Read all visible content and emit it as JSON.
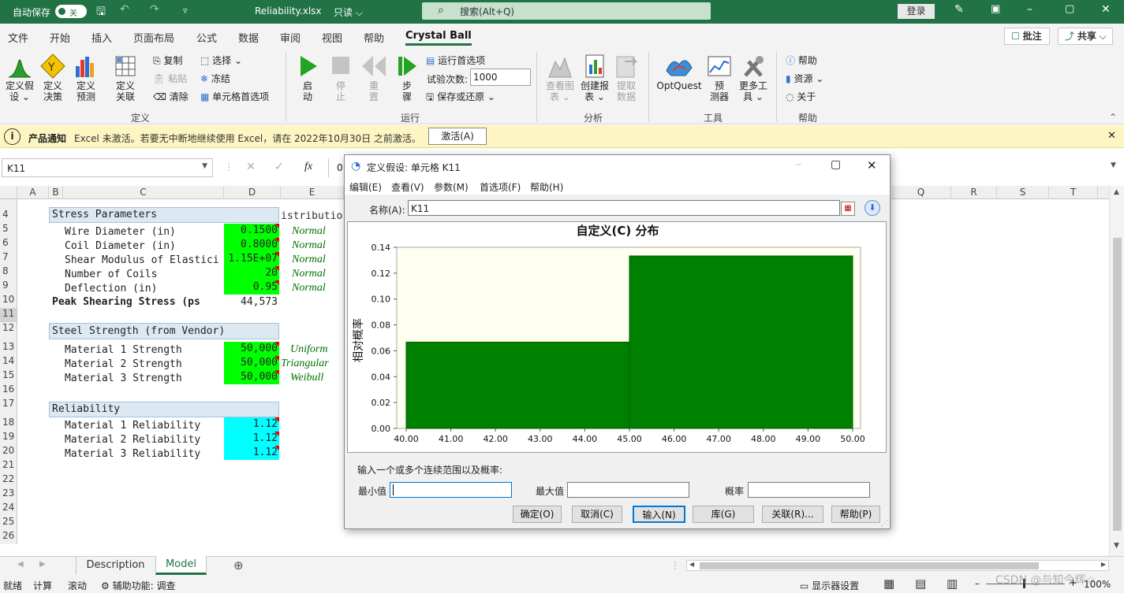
{
  "titlebar": {
    "autosave_label": "自动保存",
    "autosave_state": "关",
    "filename": "Reliability.xlsx",
    "mode": "只读",
    "search_placeholder": "搜索(Alt+Q)",
    "login": "登录"
  },
  "menu": {
    "tabs": [
      "文件",
      "开始",
      "插入",
      "页面布局",
      "公式",
      "数据",
      "审阅",
      "视图",
      "帮助",
      "Crystal Ball"
    ],
    "active_tab": "Crystal Ball",
    "comments_btn": "批注",
    "share_btn": "共享"
  },
  "ribbon": {
    "define": {
      "def_assumption": [
        "定义假",
        "设 ⌄"
      ],
      "def_decision": [
        "定义",
        "决策"
      ],
      "def_forecast": [
        "定义",
        "预测"
      ],
      "def_correlation": [
        "定义",
        "关联"
      ],
      "copy": "复制",
      "paste": "粘贴",
      "clear": "清除",
      "select": "选择 ⌄",
      "freeze": "冻结",
      "cell_prefs": "单元格首选项",
      "group": "定义"
    },
    "run": {
      "start": [
        "启",
        "动"
      ],
      "stop": [
        "停",
        "止"
      ],
      "reset": [
        "重",
        "置"
      ],
      "step": [
        "步",
        "骤"
      ],
      "run_prefs": "运行首选项",
      "trials_label": "试验次数:",
      "trials_value": "1000",
      "save_restore": "保存或还原 ⌄",
      "group": "运行"
    },
    "analyze": {
      "view_charts": [
        "查看图",
        "表 ⌄"
      ],
      "create_report": [
        "创建报",
        "表 ⌄"
      ],
      "extract_data": [
        "提取",
        "数据"
      ],
      "group": "分析"
    },
    "tools": {
      "optquest": "OptQuest",
      "predictor": [
        "预",
        "测器"
      ],
      "more_tools": [
        "更多工",
        "具 ⌄"
      ],
      "group": "工具"
    },
    "help": {
      "help": "帮助",
      "resources": "资源 ⌄",
      "about": "关于",
      "group": "帮助"
    }
  },
  "notice": {
    "title": "产品通知",
    "message": "Excel 未激活。若要无中断地继续使用 Excel，请在 2022年10月30日 之前激活。",
    "button": "激活(A)"
  },
  "formula_bar": {
    "name_box": "K11",
    "fx": "fx",
    "content": "0"
  },
  "grid": {
    "columns": [
      "A",
      "B",
      "C",
      "D",
      "E",
      "Q",
      "R",
      "S",
      "T"
    ],
    "rows": [
      "4",
      "5",
      "6",
      "7",
      "8",
      "9",
      "10",
      "11",
      "12",
      "13",
      "14",
      "15",
      "16",
      "17",
      "18",
      "19",
      "20",
      "21",
      "22",
      "23",
      "24",
      "25",
      "26"
    ],
    "stress_header": "Stress Parameters",
    "e4_text": "istributio",
    "stress_rows": [
      {
        "label": "Wire Diameter (in)",
        "value": "0.1500",
        "dist": "Normal"
      },
      {
        "label": "Coil Diameter (in)",
        "value": "0.8000",
        "dist": "Normal"
      },
      {
        "label": "Shear Modulus of Elastici",
        "value": "1.15E+07",
        "dist": "Normal"
      },
      {
        "label": "Number of Coils",
        "value": "20",
        "dist": "Normal"
      },
      {
        "label": "Deflection (in)",
        "value": "0.95",
        "dist": "Normal"
      }
    ],
    "peak_label": "Peak Shearing Stress (ps",
    "peak_value": "44,573",
    "steel_header": "Steel Strength (from Vendor)",
    "steel_rows": [
      {
        "label": "Material 1 Strength",
        "value": "50,000",
        "dist": "Uniform"
      },
      {
        "label": "Material 2 Strength",
        "value": "50,000",
        "dist": "Triangular"
      },
      {
        "label": "Material 3 Strength",
        "value": "50,000",
        "dist": "Weibull"
      }
    ],
    "rel_header": "Reliability",
    "rel_rows": [
      {
        "label": "Material 1 Reliability",
        "value": "1.12"
      },
      {
        "label": "Material 2 Reliability",
        "value": "1.12"
      },
      {
        "label": "Material 3 Reliability",
        "value": "1.12"
      }
    ]
  },
  "sheets": {
    "tabs": [
      "Description",
      "Model"
    ],
    "active": "Model"
  },
  "status": {
    "ready": "就绪",
    "calc": "计算",
    "scroll": "滚动",
    "accessibility": "辅助功能: 调查",
    "display": "显示器设置",
    "zoom": "100%",
    "watermark": "CSDN @与知今辉☆"
  },
  "dialog": {
    "title": "定义假设: 单元格 K11",
    "menus": [
      "编辑(E)",
      "查看(V)",
      "参数(M)",
      "首选项(F)",
      "帮助(H)"
    ],
    "name_label": "名称(A):",
    "name_value": "K11",
    "range_prompt": "输入一个或多个连续范围以及概率:",
    "min_label": "最小值",
    "max_label": "最大值",
    "prob_label": "概率",
    "buttons": [
      "确定(O)",
      "取消(C)",
      "输入(N)",
      "库(G)",
      "关联(R)...",
      "帮助(P)"
    ],
    "colors": {
      "bar": "#008000",
      "plot_bg": "#fffff0"
    }
  },
  "chart_data": {
    "type": "bar",
    "title": "自定义(C) 分布",
    "ylabel": "相对概率",
    "xlabel": "",
    "x_ticks": [
      "40.00",
      "41.00",
      "42.00",
      "43.00",
      "44.00",
      "45.00",
      "46.00",
      "47.00",
      "48.00",
      "49.00",
      "50.00"
    ],
    "y_ticks": [
      "0.00",
      "0.02",
      "0.04",
      "0.06",
      "0.08",
      "0.10",
      "0.12",
      "0.14"
    ],
    "xlim": [
      40,
      50
    ],
    "ylim": [
      0,
      0.14
    ],
    "series": [
      {
        "values": [
          {
            "x0": 40,
            "x1": 45,
            "y": 0.0667
          },
          {
            "x0": 45,
            "x1": 50,
            "y": 0.1333
          }
        ]
      }
    ]
  }
}
